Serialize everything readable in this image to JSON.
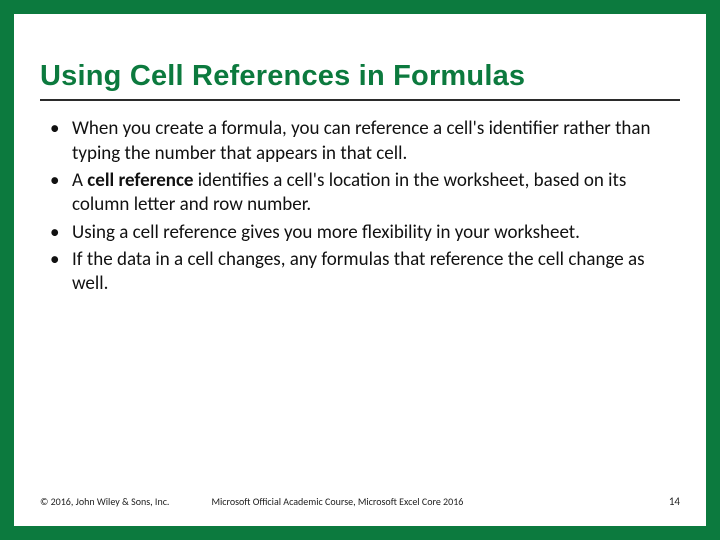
{
  "slide": {
    "title": "Using Cell References in Formulas",
    "bullets": [
      {
        "pre": "When you create a formula, you can reference a cell's identifier rather than typing the number that appears in that cell.",
        "bold": "",
        "post": ""
      },
      {
        "pre": "A ",
        "bold": "cell reference",
        "post": " identifies a cell's location in the worksheet, based on its column letter and row number."
      },
      {
        "pre": "Using a cell reference gives you more flexibility in your worksheet.",
        "bold": "",
        "post": ""
      },
      {
        "pre": "If the data in a cell changes, any formulas that reference the cell change as well.",
        "bold": "",
        "post": ""
      }
    ],
    "footer": {
      "copyright": "© 2016, John Wiley & Sons, Inc.",
      "course": "Microsoft Official Academic Course, Microsoft Excel Core 2016",
      "page": "14"
    }
  }
}
